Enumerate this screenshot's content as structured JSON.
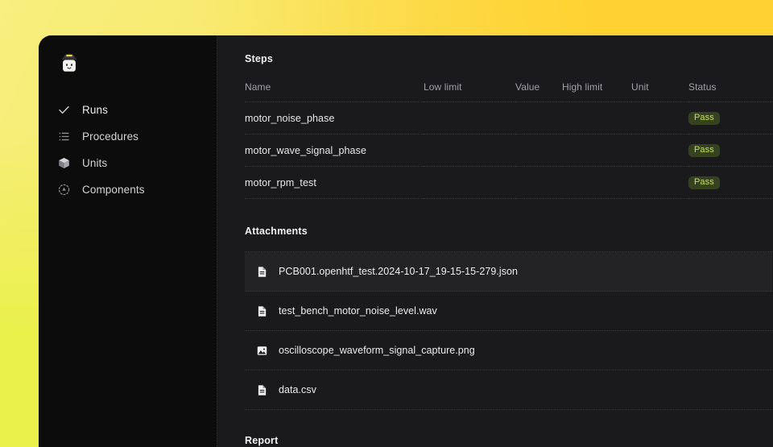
{
  "theme": {
    "background_gradient_from": "#f7ef7e",
    "background_gradient_to": "#ffd231",
    "panel_bg": "#1a1a1c",
    "sidebar_bg": "#0c0c0d",
    "accent_badge_bg": "#36421f",
    "accent_badge_text": "#c7e05c",
    "row_highlight_bg": "#232325"
  },
  "sidebar": {
    "logo": {
      "icon": "robot-conductor-logo"
    },
    "items": [
      {
        "label": "Runs",
        "icon": "check-icon",
        "active": true
      },
      {
        "label": "Procedures",
        "icon": "list-icon",
        "active": false
      },
      {
        "label": "Units",
        "icon": "cube-icon",
        "active": false
      },
      {
        "label": "Components",
        "icon": "components-icon",
        "active": false
      }
    ]
  },
  "main": {
    "steps": {
      "title": "Steps",
      "columns": [
        "Name",
        "Low limit",
        "Value",
        "High limit",
        "Unit",
        "Status"
      ],
      "rows": [
        {
          "name": "motor_noise_phase",
          "low_limit": "",
          "value": "",
          "high_limit": "",
          "unit": "",
          "status": "Pass"
        },
        {
          "name": "motor_wave_signal_phase",
          "low_limit": "",
          "value": "",
          "high_limit": "",
          "unit": "",
          "status": "Pass"
        },
        {
          "name": "motor_rpm_test",
          "low_limit": "",
          "value": "",
          "high_limit": "",
          "unit": "",
          "status": "Pass"
        }
      ]
    },
    "attachments": {
      "title": "Attachments",
      "items": [
        {
          "name": "PCB001.openhtf_test.2024-10-17_19-15-15-279.json",
          "icon": "file-icon",
          "highlighted": true
        },
        {
          "name": "test_bench_motor_noise_level.wav",
          "icon": "file-icon",
          "highlighted": false
        },
        {
          "name": "oscilloscope_waveform_signal_capture.png",
          "icon": "image-icon",
          "highlighted": false
        },
        {
          "name": "data.csv",
          "icon": "file-icon",
          "highlighted": false
        }
      ]
    },
    "report": {
      "title": "Report"
    }
  }
}
